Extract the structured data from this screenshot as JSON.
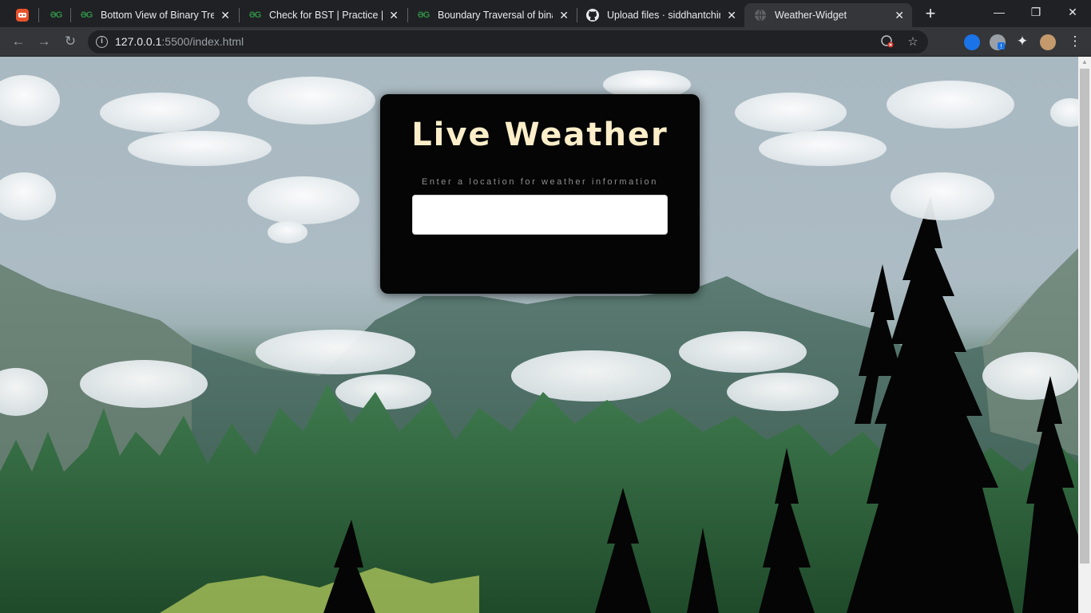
{
  "browser": {
    "tabs": [
      {
        "label": "",
        "icon": "app-icon",
        "active": false
      },
      {
        "label": "",
        "icon": "gfg-icon",
        "active": false
      },
      {
        "label": "Bottom View of Binary Tree",
        "icon": "gfg-icon",
        "active": false
      },
      {
        "label": "Check for BST | Practice | Ge",
        "icon": "gfg-icon",
        "active": false
      },
      {
        "label": "Boundary Traversal of binar",
        "icon": "gfg-icon",
        "active": false
      },
      {
        "label": "Upload files · siddhantchim",
        "icon": "github-icon",
        "active": false
      },
      {
        "label": "Weather-Widget",
        "icon": "globe-icon",
        "active": true
      }
    ],
    "url": {
      "host": "127.0.0.1",
      "path": ":5500/index.html"
    },
    "window_controls": {
      "minimize": "—",
      "restore": "❐",
      "close": "✕"
    }
  },
  "widget": {
    "title": "Live Weather",
    "prompt": "Enter a location for weather information",
    "input_value": "",
    "input_placeholder": ""
  },
  "colors": {
    "card_bg": "#050505",
    "title": "#fbeec9",
    "sky": "#a9b9c1",
    "forest": "#2f5a3c"
  }
}
